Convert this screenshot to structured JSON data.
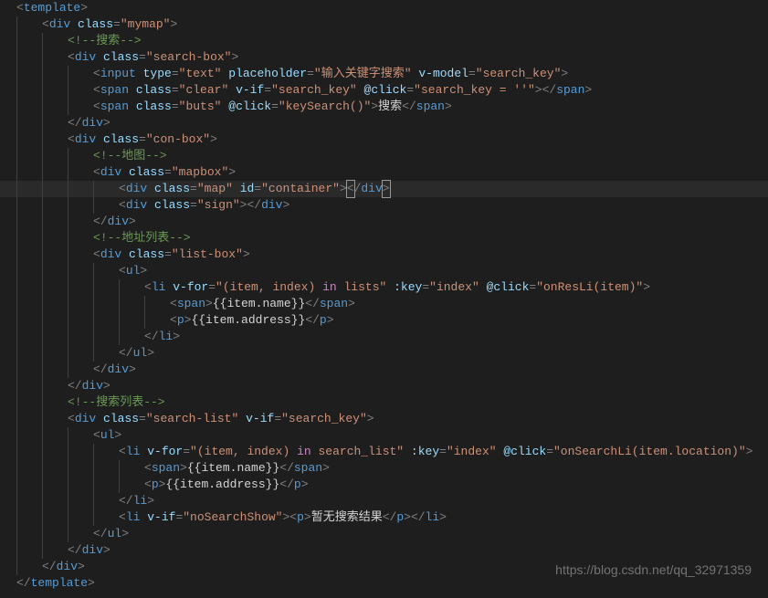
{
  "watermark": "https://blog.csdn.net/qq_32971359",
  "lines": [
    {
      "indent": 0,
      "tokens": [
        [
          "punct",
          "<"
        ],
        [
          "tag",
          "template"
        ],
        [
          "punct",
          ">"
        ]
      ]
    },
    {
      "indent": 1,
      "tokens": [
        [
          "punct",
          "<"
        ],
        [
          "tag",
          "div "
        ],
        [
          "attr",
          "class"
        ],
        [
          "punct",
          "="
        ],
        [
          "str",
          "\"mymap\""
        ],
        [
          "punct",
          ">"
        ]
      ]
    },
    {
      "indent": 2,
      "tokens": [
        [
          "comment",
          "<!--搜索-->"
        ]
      ]
    },
    {
      "indent": 2,
      "tokens": [
        [
          "punct",
          "<"
        ],
        [
          "tag",
          "div "
        ],
        [
          "attr",
          "class"
        ],
        [
          "punct",
          "="
        ],
        [
          "str",
          "\"search-box\""
        ],
        [
          "punct",
          ">"
        ]
      ]
    },
    {
      "indent": 3,
      "tokens": [
        [
          "punct",
          "<"
        ],
        [
          "tag",
          "input "
        ],
        [
          "attr",
          "type"
        ],
        [
          "punct",
          "="
        ],
        [
          "str",
          "\"text\""
        ],
        [
          "tag",
          " "
        ],
        [
          "attr",
          "placeholder"
        ],
        [
          "punct",
          "="
        ],
        [
          "str",
          "\"输入关键字搜索\""
        ],
        [
          "tag",
          " "
        ],
        [
          "attr",
          "v-model"
        ],
        [
          "punct",
          "="
        ],
        [
          "str",
          "\"search_key\""
        ],
        [
          "punct",
          ">"
        ]
      ]
    },
    {
      "indent": 3,
      "tokens": [
        [
          "punct",
          "<"
        ],
        [
          "tag",
          "span "
        ],
        [
          "attr",
          "class"
        ],
        [
          "punct",
          "="
        ],
        [
          "str",
          "\"clear\""
        ],
        [
          "tag",
          " "
        ],
        [
          "attr",
          "v-if"
        ],
        [
          "punct",
          "="
        ],
        [
          "str",
          "\"search_key\""
        ],
        [
          "tag",
          " "
        ],
        [
          "attr",
          "@click"
        ],
        [
          "punct",
          "="
        ],
        [
          "str",
          "\"search_key = ''\""
        ],
        [
          "punct",
          "></"
        ],
        [
          "tag",
          "span"
        ],
        [
          "punct",
          ">"
        ]
      ]
    },
    {
      "indent": 3,
      "tokens": [
        [
          "punct",
          "<"
        ],
        [
          "tag",
          "span "
        ],
        [
          "attr",
          "class"
        ],
        [
          "punct",
          "="
        ],
        [
          "str",
          "\"buts\""
        ],
        [
          "tag",
          " "
        ],
        [
          "attr",
          "@click"
        ],
        [
          "punct",
          "="
        ],
        [
          "str",
          "\"keySearch()\""
        ],
        [
          "punct",
          ">"
        ],
        [
          "mustache",
          "搜索"
        ],
        [
          "punct",
          "</"
        ],
        [
          "tag",
          "span"
        ],
        [
          "punct",
          ">"
        ]
      ]
    },
    {
      "indent": 2,
      "tokens": [
        [
          "punct",
          "</"
        ],
        [
          "tag",
          "div"
        ],
        [
          "punct",
          ">"
        ]
      ]
    },
    {
      "indent": 2,
      "tokens": [
        [
          "punct",
          "<"
        ],
        [
          "tag",
          "div "
        ],
        [
          "attr",
          "class"
        ],
        [
          "punct",
          "="
        ],
        [
          "str",
          "\"con-box\""
        ],
        [
          "punct",
          ">"
        ]
      ]
    },
    {
      "indent": 3,
      "tokens": [
        [
          "comment",
          "<!--地图-->"
        ]
      ]
    },
    {
      "indent": 3,
      "tokens": [
        [
          "punct",
          "<"
        ],
        [
          "tag",
          "div "
        ],
        [
          "attr",
          "class"
        ],
        [
          "punct",
          "="
        ],
        [
          "str",
          "\"mapbox\""
        ],
        [
          "punct",
          ">"
        ]
      ]
    },
    {
      "indent": 4,
      "hl": true,
      "tokens": [
        [
          "punct",
          "<"
        ],
        [
          "tag",
          "div "
        ],
        [
          "attr",
          "class"
        ],
        [
          "punct",
          "="
        ],
        [
          "str",
          "\"map\""
        ],
        [
          "tag",
          " "
        ],
        [
          "attr",
          "id"
        ],
        [
          "punct",
          "="
        ],
        [
          "str",
          "\"container\""
        ],
        [
          "punct",
          ">"
        ],
        [
          "box",
          "<"
        ],
        [
          "punct",
          "/"
        ],
        [
          "tag",
          "div"
        ],
        [
          "box",
          ">"
        ]
      ]
    },
    {
      "indent": 4,
      "tokens": [
        [
          "punct",
          "<"
        ],
        [
          "tag",
          "div "
        ],
        [
          "attr",
          "class"
        ],
        [
          "punct",
          "="
        ],
        [
          "str",
          "\"sign\""
        ],
        [
          "punct",
          "></"
        ],
        [
          "tag",
          "div"
        ],
        [
          "punct",
          ">"
        ]
      ]
    },
    {
      "indent": 3,
      "tokens": [
        [
          "punct",
          "</"
        ],
        [
          "tag",
          "div"
        ],
        [
          "punct",
          ">"
        ]
      ]
    },
    {
      "indent": 3,
      "tokens": [
        [
          "comment",
          "<!--地址列表-->"
        ]
      ]
    },
    {
      "indent": 3,
      "tokens": [
        [
          "punct",
          "<"
        ],
        [
          "tag",
          "div "
        ],
        [
          "attr",
          "class"
        ],
        [
          "punct",
          "="
        ],
        [
          "str",
          "\"list-box\""
        ],
        [
          "punct",
          ">"
        ]
      ]
    },
    {
      "indent": 4,
      "tokens": [
        [
          "punct",
          "<"
        ],
        [
          "tag",
          "ul"
        ],
        [
          "punct",
          ">"
        ]
      ]
    },
    {
      "indent": 5,
      "tokens": [
        [
          "punct",
          "<"
        ],
        [
          "tag",
          "li "
        ],
        [
          "attr",
          "v-for"
        ],
        [
          "punct",
          "="
        ],
        [
          "str",
          "\"(item, index) "
        ],
        [
          "kw",
          "in"
        ],
        [
          "str",
          " lists\""
        ],
        [
          "tag",
          " "
        ],
        [
          "attr",
          ":key"
        ],
        [
          "punct",
          "="
        ],
        [
          "str",
          "\"index\""
        ],
        [
          "tag",
          " "
        ],
        [
          "attr",
          "@click"
        ],
        [
          "punct",
          "="
        ],
        [
          "str",
          "\"onResLi(item)\""
        ],
        [
          "punct",
          ">"
        ]
      ]
    },
    {
      "indent": 6,
      "tokens": [
        [
          "punct",
          "<"
        ],
        [
          "tag",
          "span"
        ],
        [
          "punct",
          ">"
        ],
        [
          "mustache",
          "{{item.name}}"
        ],
        [
          "punct",
          "</"
        ],
        [
          "tag",
          "span"
        ],
        [
          "punct",
          ">"
        ]
      ]
    },
    {
      "indent": 6,
      "tokens": [
        [
          "punct",
          "<"
        ],
        [
          "tag",
          "p"
        ],
        [
          "punct",
          ">"
        ],
        [
          "mustache",
          "{{item.address}}"
        ],
        [
          "punct",
          "</"
        ],
        [
          "tag",
          "p"
        ],
        [
          "punct",
          ">"
        ]
      ]
    },
    {
      "indent": 5,
      "tokens": [
        [
          "punct",
          "</"
        ],
        [
          "tag",
          "li"
        ],
        [
          "punct",
          ">"
        ]
      ]
    },
    {
      "indent": 4,
      "tokens": [
        [
          "punct",
          "</"
        ],
        [
          "tag",
          "ul"
        ],
        [
          "punct",
          ">"
        ]
      ]
    },
    {
      "indent": 3,
      "tokens": [
        [
          "punct",
          "</"
        ],
        [
          "tag",
          "div"
        ],
        [
          "punct",
          ">"
        ]
      ]
    },
    {
      "indent": 2,
      "tokens": [
        [
          "punct",
          "</"
        ],
        [
          "tag",
          "div"
        ],
        [
          "punct",
          ">"
        ]
      ]
    },
    {
      "indent": 2,
      "tokens": [
        [
          "comment",
          "<!--搜索列表-->"
        ]
      ]
    },
    {
      "indent": 2,
      "tokens": [
        [
          "punct",
          "<"
        ],
        [
          "tag",
          "div "
        ],
        [
          "attr",
          "class"
        ],
        [
          "punct",
          "="
        ],
        [
          "str",
          "\"search-list\""
        ],
        [
          "tag",
          " "
        ],
        [
          "attr",
          "v-if"
        ],
        [
          "punct",
          "="
        ],
        [
          "str",
          "\"search_key\""
        ],
        [
          "punct",
          ">"
        ]
      ]
    },
    {
      "indent": 3,
      "tokens": [
        [
          "punct",
          "<"
        ],
        [
          "tag",
          "ul"
        ],
        [
          "punct",
          ">"
        ]
      ]
    },
    {
      "indent": 4,
      "tokens": [
        [
          "punct",
          "<"
        ],
        [
          "tag",
          "li "
        ],
        [
          "attr",
          "v-for"
        ],
        [
          "punct",
          "="
        ],
        [
          "str",
          "\"(item, index) "
        ],
        [
          "kw",
          "in"
        ],
        [
          "str",
          " search_list\""
        ],
        [
          "tag",
          " "
        ],
        [
          "attr",
          ":key"
        ],
        [
          "punct",
          "="
        ],
        [
          "str",
          "\"index\""
        ],
        [
          "tag",
          " "
        ],
        [
          "attr",
          "@click"
        ],
        [
          "punct",
          "="
        ],
        [
          "str",
          "\"onSearchLi(item.location)\""
        ],
        [
          "punct",
          ">"
        ]
      ]
    },
    {
      "indent": 5,
      "tokens": [
        [
          "punct",
          "<"
        ],
        [
          "tag",
          "span"
        ],
        [
          "punct",
          ">"
        ],
        [
          "mustache",
          "{{item.name}}"
        ],
        [
          "punct",
          "</"
        ],
        [
          "tag",
          "span"
        ],
        [
          "punct",
          ">"
        ]
      ]
    },
    {
      "indent": 5,
      "tokens": [
        [
          "punct",
          "<"
        ],
        [
          "tag",
          "p"
        ],
        [
          "punct",
          ">"
        ],
        [
          "mustache",
          "{{item.address}}"
        ],
        [
          "punct",
          "</"
        ],
        [
          "tag",
          "p"
        ],
        [
          "punct",
          ">"
        ]
      ]
    },
    {
      "indent": 4,
      "tokens": [
        [
          "punct",
          "</"
        ],
        [
          "tag",
          "li"
        ],
        [
          "punct",
          ">"
        ]
      ]
    },
    {
      "indent": 4,
      "tokens": [
        [
          "punct",
          "<"
        ],
        [
          "tag",
          "li "
        ],
        [
          "attr",
          "v-if"
        ],
        [
          "punct",
          "="
        ],
        [
          "str",
          "\"noSearchShow\""
        ],
        [
          "punct",
          "><"
        ],
        [
          "tag",
          "p"
        ],
        [
          "punct",
          ">"
        ],
        [
          "mustache",
          "暂无搜索结果"
        ],
        [
          "punct",
          "</"
        ],
        [
          "tag",
          "p"
        ],
        [
          "punct",
          "></"
        ],
        [
          "tag",
          "li"
        ],
        [
          "punct",
          ">"
        ]
      ]
    },
    {
      "indent": 3,
      "tokens": [
        [
          "punct",
          "</"
        ],
        [
          "tag",
          "ul"
        ],
        [
          "punct",
          ">"
        ]
      ]
    },
    {
      "indent": 2,
      "tokens": [
        [
          "punct",
          "</"
        ],
        [
          "tag",
          "div"
        ],
        [
          "punct",
          ">"
        ]
      ]
    },
    {
      "indent": 1,
      "tokens": [
        [
          "punct",
          "</"
        ],
        [
          "tag",
          "div"
        ],
        [
          "punct",
          ">"
        ]
      ]
    },
    {
      "indent": 0,
      "tokens": [
        [
          "punct",
          "</"
        ],
        [
          "tag",
          "template"
        ],
        [
          "punct",
          ">"
        ]
      ]
    }
  ]
}
